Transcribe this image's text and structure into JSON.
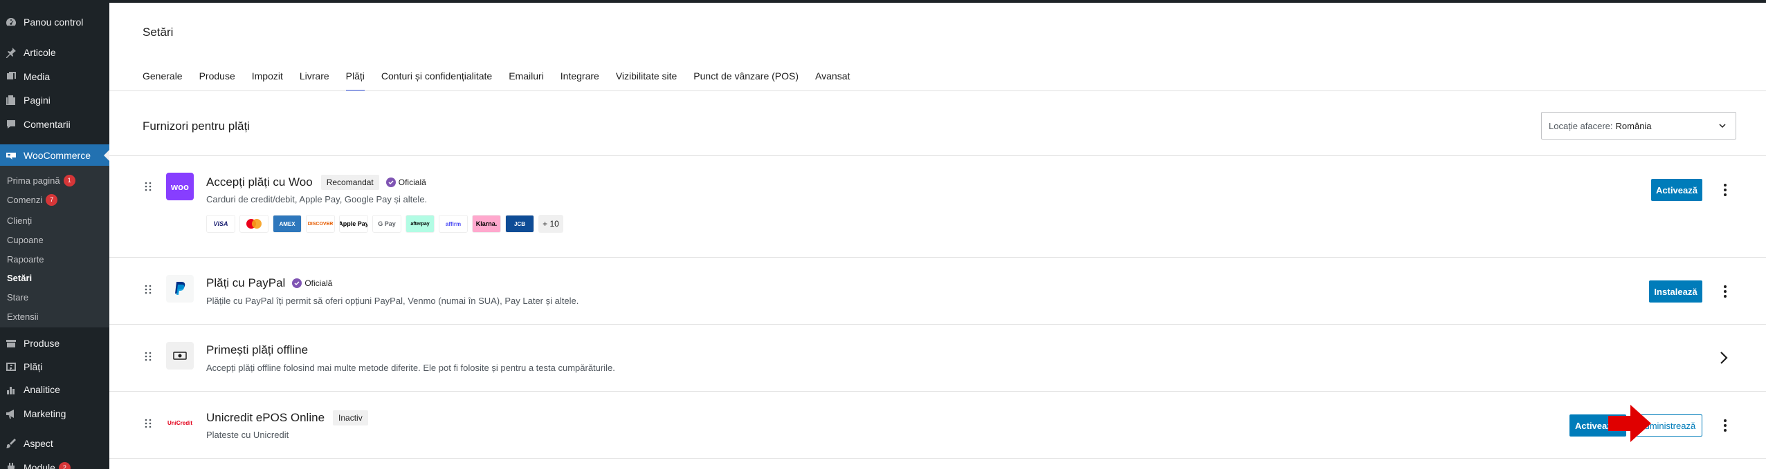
{
  "sidebar": {
    "items": [
      {
        "label": "Panou control",
        "icon": "dashboard-icon"
      },
      {
        "label": "Articole",
        "icon": "pin-icon"
      },
      {
        "label": "Media",
        "icon": "media-icon"
      },
      {
        "label": "Pagini",
        "icon": "pages-icon"
      },
      {
        "label": "Comentarii",
        "icon": "comments-icon"
      },
      {
        "label": "WooCommerce",
        "icon": "woocommerce-icon"
      },
      {
        "label": "Produse",
        "icon": "products-icon"
      },
      {
        "label": "Plăți",
        "icon": "payments-icon"
      },
      {
        "label": "Analitice",
        "icon": "analytics-icon"
      },
      {
        "label": "Marketing",
        "icon": "marketing-icon"
      },
      {
        "label": "Aspect",
        "icon": "appearance-icon"
      },
      {
        "label": "Module",
        "icon": "plugins-icon"
      }
    ],
    "submenu": [
      {
        "label": "Prima pagină",
        "badge": "1"
      },
      {
        "label": "Comenzi",
        "badge": "7"
      },
      {
        "label": "Clienți"
      },
      {
        "label": "Cupoane"
      },
      {
        "label": "Rapoarte"
      },
      {
        "label": "Setări"
      },
      {
        "label": "Stare"
      },
      {
        "label": "Extensii"
      }
    ],
    "module_badge": "2"
  },
  "header": {
    "title": "Setări",
    "tabs": [
      "Generale",
      "Produse",
      "Impozit",
      "Livrare",
      "Plăți",
      "Conturi și confidențialitate",
      "Emailuri",
      "Integrare",
      "Vizibilitate site",
      "Punct de vânzare (POS)",
      "Avansat"
    ],
    "active_tab": "Plăți"
  },
  "section": {
    "title": "Furnizori pentru plăți",
    "location_label": "Locație afacere:",
    "location_value": "România"
  },
  "providers": [
    {
      "title": "Accepți plăți cu Woo",
      "badge": "Recomandat",
      "official": "Oficială",
      "description": "Carduri de credit/debit, Apple Pay, Google Pay și altele.",
      "logo_text": "woo",
      "methods": [
        "VISA",
        "Mastercard",
        "AMEX",
        "DISCOVER",
        "Apple Pay",
        "G Pay",
        "afterpay",
        "affirm",
        "Klarna.",
        "JCB"
      ],
      "more": "+ 10",
      "action": "Activează"
    },
    {
      "title": "Plăți cu PayPal",
      "official": "Oficială",
      "description": "Plățile cu PayPal îți permit să oferi opțiuni PayPal, Venmo (numai în SUA), Pay Later și altele.",
      "action": "Instalează"
    },
    {
      "title": "Primești plăți offline",
      "description": "Accepți plăți offline folosind mai multe metode diferite. Ele pot fi folosite și pentru a testa cumpărăturile."
    },
    {
      "title": "Unicredit ePOS Online",
      "badge": "Inactiv",
      "description": "Plateste cu Unicredit",
      "logo_text": "UniCredit",
      "action_primary": "Activează",
      "action_secondary": "Administrează"
    }
  ],
  "colors": {
    "sidebar_bg": "#1d2327",
    "accent": "#007cba",
    "woo_purple": "#7f54b3",
    "arrow_red": "#e00000"
  }
}
